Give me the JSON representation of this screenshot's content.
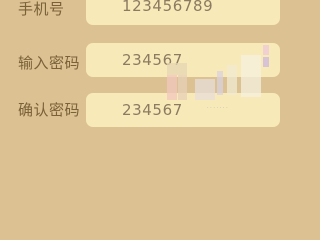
{
  "form": {
    "phone": {
      "label": "手机号",
      "value": "123456789"
    },
    "password": {
      "label": "输入密码",
      "value": "234567"
    },
    "confirm_password": {
      "label": "确认密码",
      "value": "234567"
    }
  },
  "colors": {
    "background": "#dcc193",
    "field_background": "#f7eab8",
    "label_text": "#7a6137",
    "field_text": "#8c7a61"
  }
}
